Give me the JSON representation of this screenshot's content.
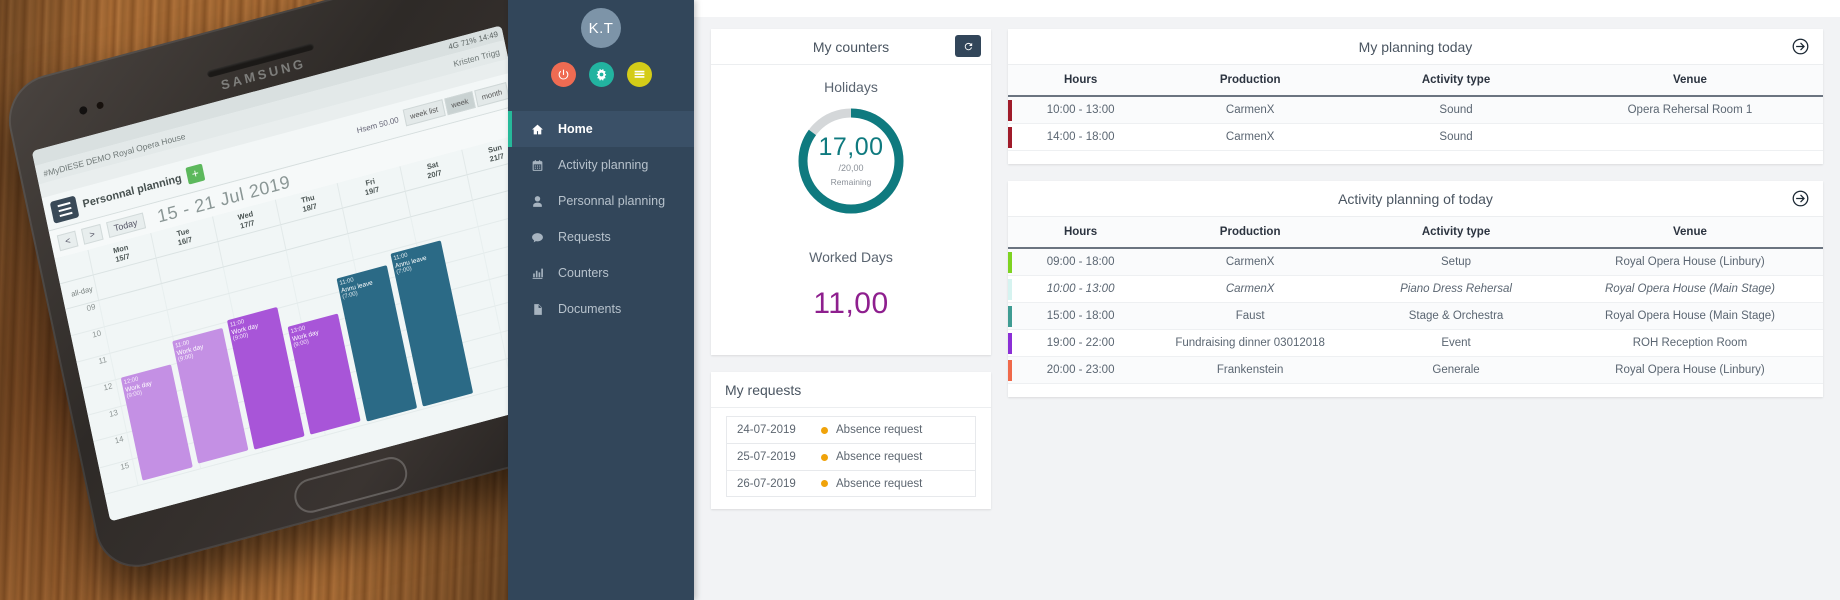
{
  "photo": {
    "phone_brand": "SAMSUNG",
    "status_bar": "4G 71% 14:49",
    "app_bar": "#MyDIESE DEMO Royal Opera House",
    "user_name": "Kristen Trigg",
    "screen_title": "Personnal planning",
    "today_button": "Today",
    "add_button": "+",
    "hsem": "Hsem 50.00",
    "view_options": [
      "week list",
      "week",
      "month"
    ],
    "selected_view": "week",
    "prev_button": "<",
    "next_button": ">",
    "week_range": "15 - 21 Jul 2019",
    "days": [
      {
        "name": "Mon",
        "date": "15/7"
      },
      {
        "name": "Tue",
        "date": "16/7"
      },
      {
        "name": "Wed",
        "date": "17/7"
      },
      {
        "name": "Thu",
        "date": "18/7"
      },
      {
        "name": "Fri",
        "date": "19/7"
      },
      {
        "name": "Sat",
        "date": "20/7"
      },
      {
        "name": "Sun",
        "date": "21/7"
      }
    ],
    "all_day_label": "all-day",
    "hour_labels": [
      "09",
      "10",
      "11",
      "12",
      "13",
      "14",
      "15"
    ],
    "events": [
      {
        "time": "12:00",
        "label": "Work day",
        "value": "(9:00)",
        "color": "purple-l"
      },
      {
        "time": "11:00",
        "label": "Work day",
        "value": "(9:00)",
        "color": "purple-l"
      },
      {
        "time": "11:00",
        "label": "Work day",
        "value": "(9:00)",
        "color": "purple"
      },
      {
        "time": "13:00",
        "label": "Work day",
        "value": "(9:00)",
        "color": "purple"
      },
      {
        "time": "11:00",
        "label": "Annu leave",
        "value": "(7:00)",
        "color": "teal"
      },
      {
        "time": "11:00",
        "label": "Annu leave",
        "value": "(7:00)",
        "color": "teal"
      }
    ]
  },
  "sidebar": {
    "avatar_initials": "K.T",
    "quick_actions": [
      {
        "name": "power-icon",
        "color": "#ef6b52"
      },
      {
        "name": "settings-icon",
        "color": "#22b3a0"
      },
      {
        "name": "list-icon",
        "color": "#d4cc18"
      }
    ],
    "items": [
      {
        "label": "Home",
        "icon": "home-icon",
        "active": true
      },
      {
        "label": "Activity planning",
        "icon": "calendar-icon",
        "active": false
      },
      {
        "label": "Personnal planning",
        "icon": "user-icon",
        "active": false
      },
      {
        "label": "Requests",
        "icon": "chat-icon",
        "active": false
      },
      {
        "label": "Counters",
        "icon": "chart-icon",
        "active": false
      },
      {
        "label": "Documents",
        "icon": "document-icon",
        "active": false
      }
    ],
    "accent_color": "#26b99a",
    "background_color": "#32465a"
  },
  "counters": {
    "title": "My counters",
    "refresh_label": "refresh",
    "holidays": {
      "label": "Holidays",
      "value": "17,00",
      "total": "/20,00",
      "note": "Remaining",
      "percent": 85,
      "color": "#0f7a7f",
      "track_color": "#d4d7d9"
    },
    "worked_days": {
      "label": "Worked Days",
      "value": "11,00",
      "color": "#8e1f8e"
    }
  },
  "requests": {
    "title": "My requests",
    "rows": [
      {
        "date": "24-07-2019",
        "status_color": "#f0a30a",
        "label": "Absence request"
      },
      {
        "date": "25-07-2019",
        "status_color": "#f0a30a",
        "label": "Absence request"
      },
      {
        "date": "26-07-2019",
        "status_color": "#f0a30a",
        "label": "Absence request"
      }
    ]
  },
  "my_planning": {
    "title": "My planning today",
    "goto_label": "open",
    "columns": [
      "Hours",
      "Production",
      "Activity type",
      "Venue"
    ],
    "rows": [
      {
        "accent": "#a01b2a",
        "hours": "10:00 - 13:00",
        "production": "CarmenX",
        "activity": "Sound",
        "venue": "Opera Rehersal Room 1",
        "italic": false
      },
      {
        "accent": "#a01b2a",
        "hours": "14:00 - 18:00",
        "production": "CarmenX",
        "activity": "Sound",
        "venue": "",
        "italic": false
      }
    ]
  },
  "activity_planning": {
    "title": "Activity planning of today",
    "goto_label": "open",
    "columns": [
      "Hours",
      "Production",
      "Activity type",
      "Venue"
    ],
    "rows": [
      {
        "accent": "#7ed321",
        "hours": "09:00 - 18:00",
        "production": "CarmenX",
        "activity": "Setup",
        "venue": "Royal Opera House (Linbury)",
        "italic": false
      },
      {
        "accent": "#d6f3f0",
        "hours": "10:00 - 13:00",
        "production": "CarmenX",
        "activity": "Piano Dress Rehersal",
        "venue": "Royal Opera House (Main Stage)",
        "italic": true
      },
      {
        "accent": "#3f9c93",
        "hours": "15:00 - 18:00",
        "production": "Faust",
        "activity": "Stage & Orchestra",
        "venue": "Royal Opera House (Main Stage)",
        "italic": false
      },
      {
        "accent": "#8b2fd6",
        "hours": "19:00 - 22:00",
        "production": "Fundraising dinner 03012018",
        "activity": "Event",
        "venue": "ROH Reception Room",
        "italic": false
      },
      {
        "accent": "#f0694a",
        "hours": "20:00 - 23:00",
        "production": "Frankenstein",
        "activity": "Generale",
        "venue": "Royal Opera House (Linbury)",
        "italic": false
      }
    ]
  }
}
